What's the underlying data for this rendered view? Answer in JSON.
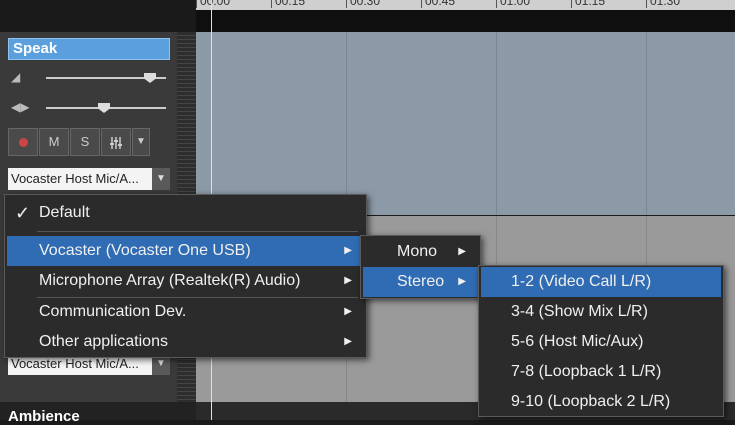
{
  "timeline": {
    "ticks": [
      "00:00",
      "00:15",
      "00:30",
      "00:45",
      "01:00",
      "01:15",
      "01:30"
    ]
  },
  "track": {
    "name": "Speak",
    "volume_icon": "speaker-icon",
    "pan_icon": "pan-icon",
    "buttons": {
      "record": "record-icon",
      "mute": "M",
      "solo": "S",
      "fx": "fx-icon"
    },
    "input": "Vocaster Host Mic/A...",
    "output": "Vocaster Host Mic/A..."
  },
  "next_track": {
    "name": "Ambience"
  },
  "menu": {
    "items": [
      {
        "label": "Default",
        "checked": true
      },
      {
        "label": "Vocaster (Vocaster One USB)",
        "has_submenu": true,
        "highlighted": true
      },
      {
        "label": "Microphone Array (Realtek(R) Audio)",
        "has_submenu": true
      },
      {
        "label": "Communication Dev.",
        "has_submenu": true
      },
      {
        "label": "Other applications",
        "has_submenu": true
      }
    ]
  },
  "submenu": {
    "items": [
      {
        "label": "Mono",
        "has_submenu": true
      },
      {
        "label": "Stereo",
        "has_submenu": true,
        "highlighted": true
      }
    ]
  },
  "channels": {
    "items": [
      {
        "label": "1-2 (Video Call L/R)",
        "highlighted": true
      },
      {
        "label": "3-4 (Show Mix L/R)"
      },
      {
        "label": "5-6 (Host Mic/Aux)"
      },
      {
        "label": "7-8 (Loopback 1 L/R)"
      },
      {
        "label": "9-10 (Loopback 2 L/R)"
      }
    ]
  },
  "colors": {
    "highlight": "#2f6cb3",
    "track_name_bg": "#5ba0dd",
    "clip_blue": "#8c9aa7"
  }
}
